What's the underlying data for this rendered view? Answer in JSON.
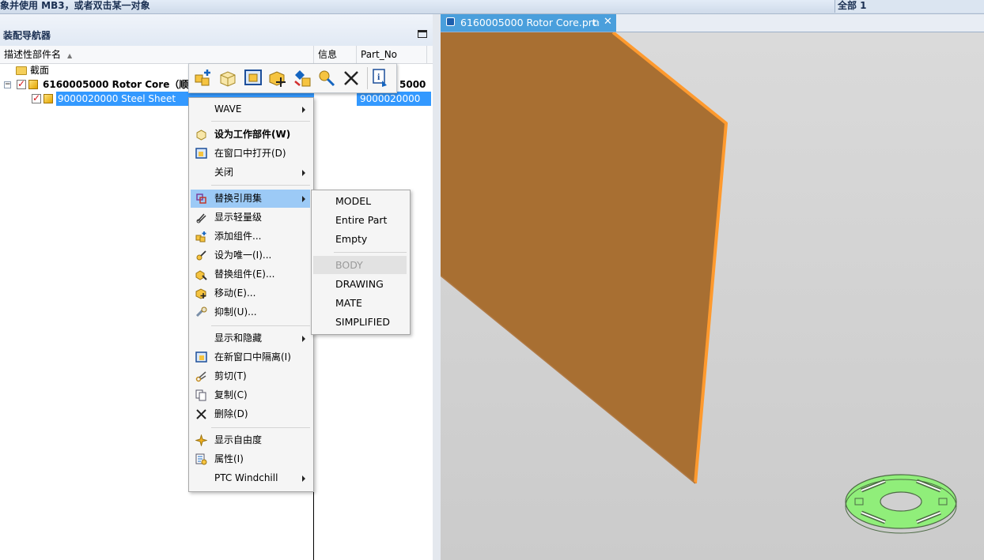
{
  "status_bar": {
    "prompt": "象并使用 MB3，或者双击某一对象",
    "filter": "全部 1"
  },
  "navigator": {
    "title": "装配导航器",
    "columns": [
      "描述性部件名",
      "信息",
      "Part_No"
    ],
    "rows": [
      {
        "label": "截面",
        "part_no": ""
      },
      {
        "label": "6160005000 Rotor Core（顺序:",
        "part_no": "5000"
      },
      {
        "label": "9000020000 Steel Sheet",
        "part_no": "9000020000"
      }
    ]
  },
  "doc_tab": {
    "label": "6160005000 Rotor Core.prt",
    "restore_icon": "float-window-icon",
    "close": "✕"
  },
  "toolbar": {
    "buttons": [
      "add-component-icon",
      "make-work-part-icon",
      "make-displayed-part-icon",
      "move-component-icon",
      "replace-component-icon",
      "make-unique-icon",
      "delete-icon",
      "info-icon"
    ]
  },
  "context_menu": {
    "items": [
      {
        "label": "WAVE",
        "submenu": true,
        "icon": ""
      },
      {
        "label": "设为工作部件(W)",
        "bold": true,
        "icon": "work-part-icon"
      },
      {
        "label": "在窗口中打开(D)",
        "icon": "open-in-window-icon"
      },
      {
        "label": "关闭",
        "submenu": true,
        "icon": ""
      },
      {
        "label": "替换引用集",
        "submenu": true,
        "active": true,
        "icon": "reference-set-icon"
      },
      {
        "label": "显示轻量级",
        "icon": "lightweight-icon"
      },
      {
        "label": "添加组件...",
        "icon": "add-component-icon"
      },
      {
        "label": "设为唯一(I)...",
        "icon": "make-unique-icon"
      },
      {
        "label": "替换组件(E)...",
        "icon": "replace-component-icon"
      },
      {
        "label": "移动(E)...",
        "icon": "move-icon"
      },
      {
        "label": "抑制(U)...",
        "icon": "suppress-icon"
      },
      {
        "label": "显示和隐藏",
        "submenu": true,
        "icon": ""
      },
      {
        "label": "在新窗口中隔离(I)",
        "icon": "isolate-icon"
      },
      {
        "label": "剪切(T)",
        "icon": "cut-icon"
      },
      {
        "label": "复制(C)",
        "icon": "copy-icon"
      },
      {
        "label": "删除(D)",
        "icon": "delete-icon"
      },
      {
        "label": "显示自由度",
        "icon": "dof-icon"
      },
      {
        "label": "属性(I)",
        "icon": "properties-icon"
      },
      {
        "label": "PTC Windchill",
        "submenu": true,
        "icon": ""
      }
    ]
  },
  "reference_set_menu": {
    "items": [
      {
        "label": "MODEL"
      },
      {
        "label": "Entire Part"
      },
      {
        "label": "Empty"
      },
      {
        "label": "BODY",
        "disabled": true
      },
      {
        "label": "DRAWING"
      },
      {
        "label": "MATE"
      },
      {
        "label": "SIMPLIFIED"
      }
    ]
  },
  "colors": {
    "selection": "#3399ff",
    "menu_highlight": "#9ccaf6",
    "part_face": "#a86f32",
    "part_edge": "#ff9a2e",
    "triad_green": "#90ee7a"
  }
}
